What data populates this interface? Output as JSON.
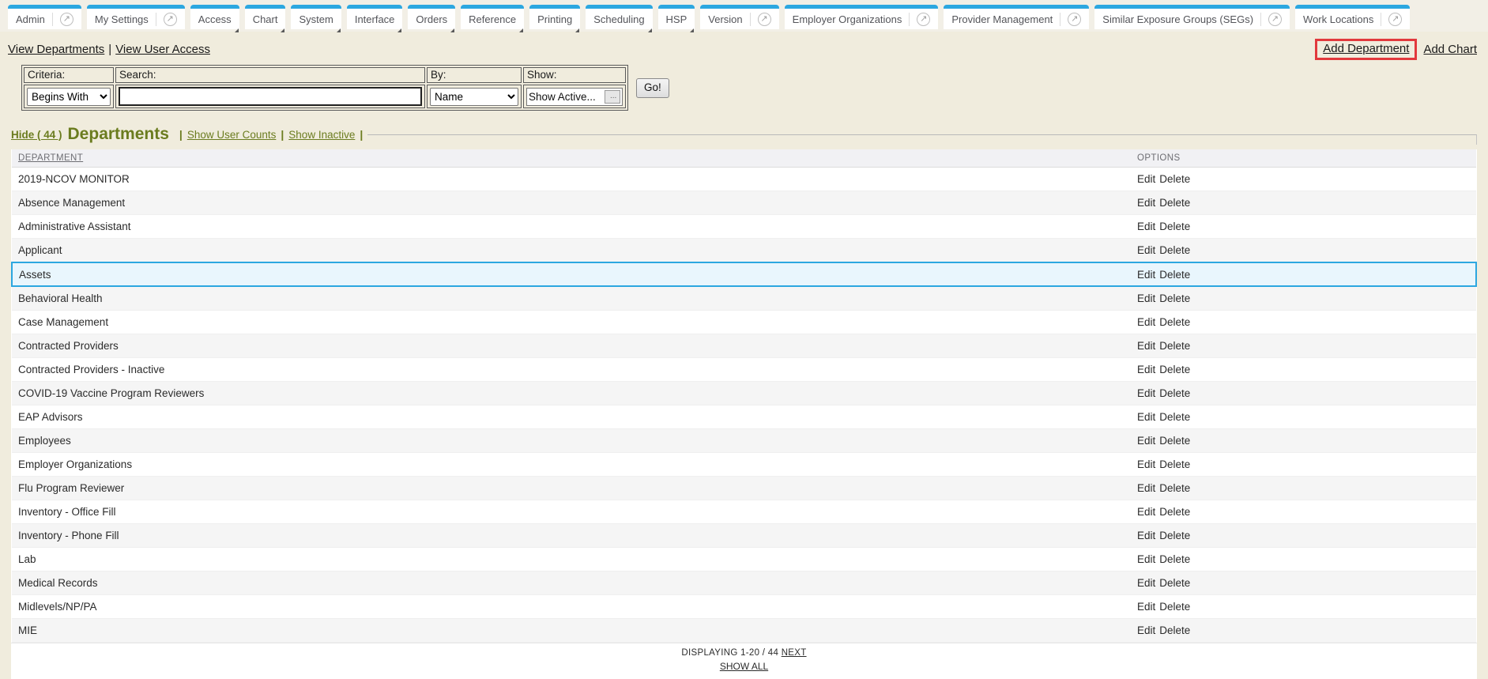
{
  "nav": {
    "tabs": [
      {
        "label": "Admin",
        "external_icon": true,
        "menu": false
      },
      {
        "label": "My Settings",
        "external_icon": true,
        "menu": false
      },
      {
        "label": "Access",
        "external_icon": false,
        "menu": true
      },
      {
        "label": "Chart",
        "external_icon": false,
        "menu": true
      },
      {
        "label": "System",
        "external_icon": false,
        "menu": true
      },
      {
        "label": "Interface",
        "external_icon": false,
        "menu": true
      },
      {
        "label": "Orders",
        "external_icon": false,
        "menu": true
      },
      {
        "label": "Reference",
        "external_icon": false,
        "menu": true
      },
      {
        "label": "Printing",
        "external_icon": false,
        "menu": true
      },
      {
        "label": "Scheduling",
        "external_icon": false,
        "menu": true
      },
      {
        "label": "HSP",
        "external_icon": false,
        "menu": true
      },
      {
        "label": "Version",
        "external_icon": true,
        "menu": false
      },
      {
        "label": "Employer Organizations",
        "external_icon": true,
        "menu": false
      },
      {
        "label": "Provider Management",
        "external_icon": true,
        "menu": false
      },
      {
        "label": "Similar Exposure Groups (SEGs)",
        "external_icon": true,
        "menu": false
      },
      {
        "label": "Work Locations",
        "external_icon": true,
        "menu": false
      }
    ]
  },
  "toolbar": {
    "view_departments": "View Departments",
    "separator": "|",
    "view_user_access": "View User Access",
    "add_department": "Add Department",
    "add_chart": "Add Chart"
  },
  "search_form": {
    "criteria_label": "Criteria:",
    "criteria_value": "Begins With",
    "search_label": "Search:",
    "search_value": "",
    "by_label": "By:",
    "by_value": "Name",
    "show_label": "Show:",
    "show_value": "Show Active...",
    "more_button": "...",
    "go_button": "Go!"
  },
  "list_header": {
    "hide_link": "Hide ( 44 )",
    "title": "Departments",
    "separator": "|",
    "show_user_counts": "Show User Counts",
    "show_inactive": "Show Inactive"
  },
  "table": {
    "columns": {
      "department": "DEPARTMENT",
      "options": "OPTIONS"
    },
    "options_labels": {
      "edit": "Edit",
      "delete": "Delete"
    },
    "selected_row": "Assets",
    "rows": [
      {
        "name": "2019-NCOV MONITOR"
      },
      {
        "name": "Absence Management"
      },
      {
        "name": "Administrative Assistant"
      },
      {
        "name": "Applicant"
      },
      {
        "name": "Assets"
      },
      {
        "name": "Behavioral Health"
      },
      {
        "name": "Case Management"
      },
      {
        "name": "Contracted Providers"
      },
      {
        "name": "Contracted Providers - Inactive"
      },
      {
        "name": "COVID-19 Vaccine Program Reviewers"
      },
      {
        "name": "EAP Advisors"
      },
      {
        "name": "Employees"
      },
      {
        "name": "Employer Organizations"
      },
      {
        "name": "Flu Program Reviewer"
      },
      {
        "name": "Inventory - Office Fill"
      },
      {
        "name": "Inventory - Phone Fill"
      },
      {
        "name": "Lab"
      },
      {
        "name": "Medical Records"
      },
      {
        "name": "Midlevels/NP/PA"
      },
      {
        "name": "MIE"
      }
    ]
  },
  "pagination": {
    "displaying": "DISPLAYING 1-20 / 44",
    "next": "NEXT",
    "show_all": "SHOW ALL"
  },
  "colors": {
    "tab_accent": "#2ca7e0",
    "olive_green": "#6b7c1f",
    "highlight_red": "#e2393d",
    "selected_row_bg": "#e9f6fd",
    "page_bg": "#f0ecdd"
  }
}
